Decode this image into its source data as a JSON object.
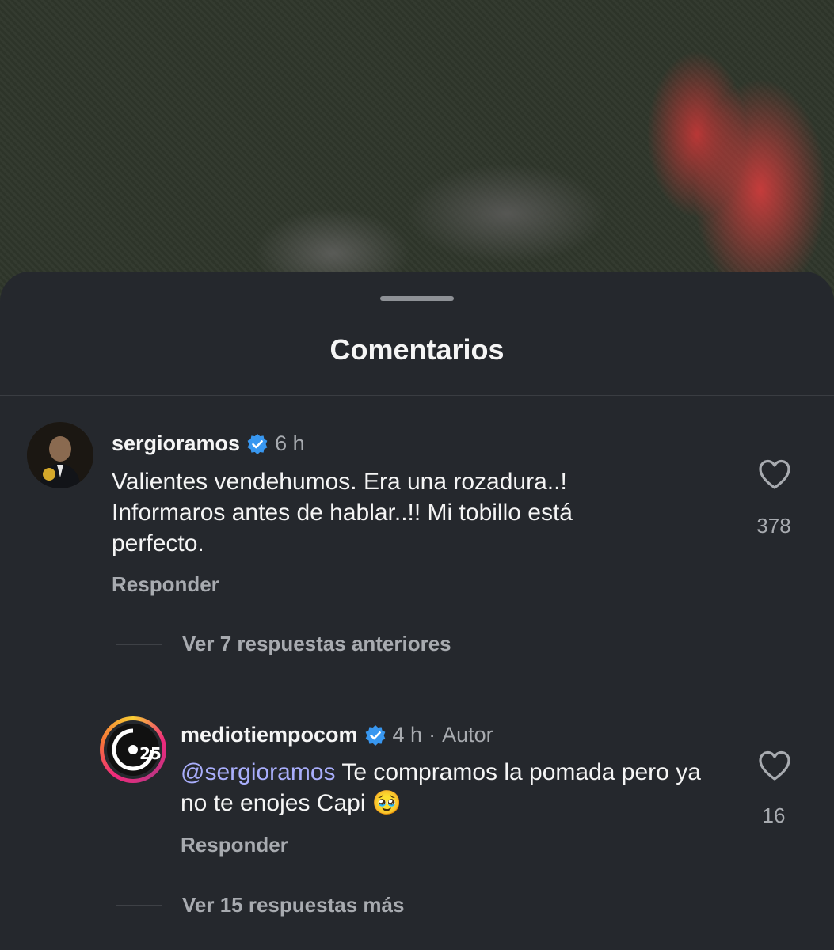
{
  "sheet": {
    "title": "Comentarios"
  },
  "comments": [
    {
      "username": "sergioramos",
      "verified": true,
      "time": "6 h",
      "text": "Valientes vendehumos. Era una rozadura..! Informaros antes de hablar..!! Mi tobillo está perfecto.",
      "reply_label": "Responder",
      "likes": "378"
    }
  ],
  "replies_thread": {
    "view_previous_label": "Ver 7 respuestas anteriores",
    "reply": {
      "username": "mediotiempocom",
      "verified": true,
      "time": "4 h",
      "separator": "·",
      "author_tag": "Autor",
      "mention": "@sergioramos",
      "text": "Te compramos la pomada pero ya no te enojes Capi",
      "emoji": "🥹",
      "reply_label": "Responder",
      "likes": "16"
    },
    "view_more_label": "Ver 15 respuestas más"
  },
  "colors": {
    "sheet_bg": "#25282d",
    "verified_blue": "#3897f0",
    "mention": "#a9aefc",
    "secondary_text": "#a8abb0"
  }
}
